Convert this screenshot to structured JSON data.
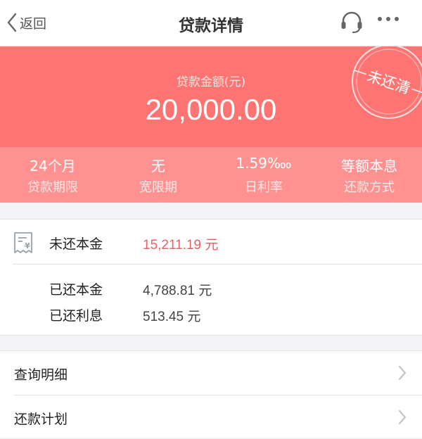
{
  "nav": {
    "back_label": "返回",
    "title": "贷款详情",
    "support_icon": "headset-icon",
    "more_icon": "more-dots-icon"
  },
  "loan": {
    "amount_label": "贷款金额(元)",
    "amount_value": "20,000.00",
    "status_stamp": "未还清",
    "stats": [
      {
        "value": "24个月",
        "label": "贷款期限"
      },
      {
        "value": "无",
        "label": "宽限期"
      },
      {
        "value": "1.59‱",
        "label": "日利率"
      },
      {
        "value": "等额本息",
        "label": "还款方式"
      }
    ]
  },
  "principal": {
    "icon": "receipt-icon",
    "unpaid_label": "未还本金",
    "unpaid_value": "15,211.19 元",
    "paid_principal_label": "已还本金",
    "paid_principal_value": "4,788.81 元",
    "paid_interest_label": "已还利息",
    "paid_interest_value": "513.45 元"
  },
  "menu": {
    "items": [
      {
        "label": "查询明细"
      },
      {
        "label": "还款计划"
      }
    ]
  },
  "colors": {
    "header_bg": "#fd7472",
    "stats_bg": "#ff9291",
    "highlight": "#ee5d60"
  }
}
